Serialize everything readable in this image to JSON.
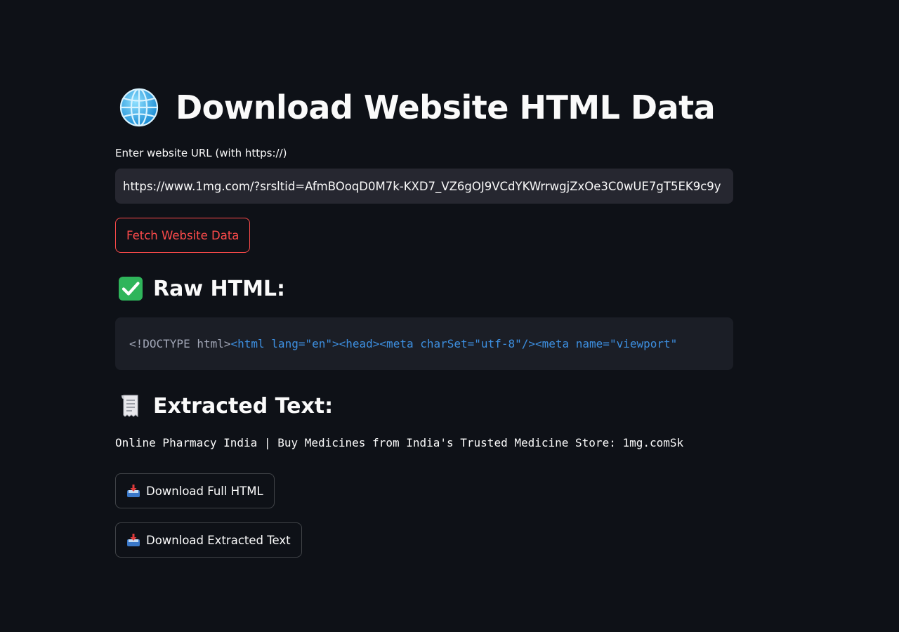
{
  "header": {
    "icon": "globe-icon",
    "title": "Download Website HTML Data"
  },
  "url_field": {
    "label": "Enter website URL (with https://)",
    "value": "https://www.1mg.com/?srsltid=AfmBOoqD0M7k-KXD7_VZ6gOJ9VCdYKWrrwgjZxOe3C0wUE7gT5EK9c9y"
  },
  "fetch_button": {
    "label": "Fetch Website Data"
  },
  "raw_html": {
    "icon": "check-mark-icon",
    "heading": "Raw HTML:",
    "code_doctype": "<!DOCTYPE html>",
    "code_tags": "<html lang=\"en\"><head><meta charSet=\"utf-8\"/><meta name=\"viewport\""
  },
  "extracted": {
    "icon": "receipt-icon",
    "heading": "Extracted Text:",
    "text": "Online Pharmacy India | Buy Medicines from India's Trusted Medicine Store: 1mg.comSk"
  },
  "downloads": {
    "icon": "inbox-tray-icon",
    "full_html_label": "Download Full HTML",
    "text_label": "Download Extracted Text"
  },
  "colors": {
    "background": "#0e1117",
    "primary": "#ff4b4b",
    "input_bg": "#262730",
    "code_bg": "#1b1e26",
    "code_tag": "#3d8fe0",
    "check_green": "#2fb55b"
  }
}
